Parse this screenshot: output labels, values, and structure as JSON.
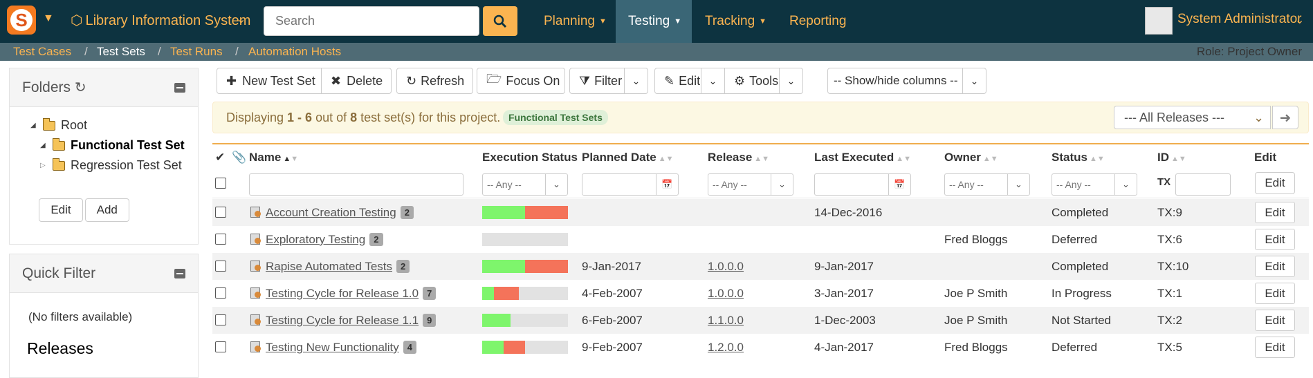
{
  "app": {
    "product_name": "Library Information System",
    "search_placeholder": "Search",
    "nav": [
      "Planning",
      "Testing",
      "Tracking",
      "Reporting"
    ],
    "nav_active": "Testing",
    "user_name": "System Administrator"
  },
  "subnav": {
    "items": [
      "Test Cases",
      "Test Sets",
      "Test Runs",
      "Automation Hosts"
    ],
    "active": "Test Sets",
    "separator": "/",
    "role": "Role: Project Owner"
  },
  "sidebar": {
    "folders_title": "Folders",
    "tree": {
      "root": "Root",
      "children": [
        "Functional Test Set",
        "Regression Test Set"
      ],
      "selected": "Functional Test Set"
    },
    "edit_label": "Edit",
    "add_label": "Add",
    "quick_filter_title": "Quick Filter",
    "no_filters": "(No filters available)",
    "releases_heading": "Releases"
  },
  "toolbar": {
    "new_label": "New Test Set",
    "delete_label": "Delete",
    "refresh_label": "Refresh",
    "focus_label": "Focus On",
    "filter_label": "Filter",
    "edit_label": "Edit",
    "tools_label": "Tools",
    "showhide_label": "-- Show/hide columns --"
  },
  "info": {
    "prefix": "Displaying ",
    "range": "1 - 6",
    "mid": " out of ",
    "total": "8",
    "suffix": " test set(s) for this project.",
    "tag": "Functional Test Sets",
    "release_select": "--- All Releases ---"
  },
  "grid": {
    "headers": {
      "name": "Name",
      "execution_status": "Execution Status",
      "planned_date": "Planned Date",
      "release": "Release",
      "last_executed": "Last Executed",
      "owner": "Owner",
      "status": "Status",
      "id": "ID",
      "edit": "Edit"
    },
    "filters": {
      "any": "-- Any --",
      "id_prefix": "TX",
      "edit_button": "Edit"
    },
    "rows": [
      {
        "name": "Account Creation Testing",
        "count": "2",
        "passed": 0.5,
        "failed": 0.5,
        "planned": "",
        "release": "",
        "last_executed": "14-Dec-2016",
        "owner": "",
        "status": "Completed",
        "id": "TX:9"
      },
      {
        "name": "Exploratory Testing",
        "count": "2",
        "passed": 0,
        "failed": 0,
        "planned": "",
        "release": "",
        "last_executed": "",
        "owner": "Fred Bloggs",
        "status": "Deferred",
        "id": "TX:6"
      },
      {
        "name": "Rapise Automated Tests",
        "count": "2",
        "passed": 0.5,
        "failed": 0.5,
        "planned": "9-Jan-2017",
        "release": "1.0.0.0",
        "last_executed": "9-Jan-2017",
        "owner": "",
        "status": "Completed",
        "id": "TX:10"
      },
      {
        "name": "Testing Cycle for Release 1.0",
        "count": "7",
        "passed": 0.14,
        "failed": 0.29,
        "planned": "4-Feb-2007",
        "release": "1.0.0.0",
        "last_executed": "3-Jan-2017",
        "owner": "Joe P Smith",
        "status": "In Progress",
        "id": "TX:1"
      },
      {
        "name": "Testing Cycle for Release 1.1",
        "count": "9",
        "passed": 0.33,
        "failed": 0,
        "planned": "6-Feb-2007",
        "release": "1.1.0.0",
        "last_executed": "1-Dec-2003",
        "owner": "Joe P Smith",
        "status": "Not Started",
        "id": "TX:2"
      },
      {
        "name": "Testing New Functionality",
        "count": "4",
        "passed": 0.25,
        "failed": 0.25,
        "planned": "9-Feb-2007",
        "release": "1.2.0.0",
        "last_executed": "4-Jan-2017",
        "owner": "Fred Bloggs",
        "status": "Deferred",
        "id": "TX:5"
      }
    ],
    "row_edit_label": "Edit"
  }
}
